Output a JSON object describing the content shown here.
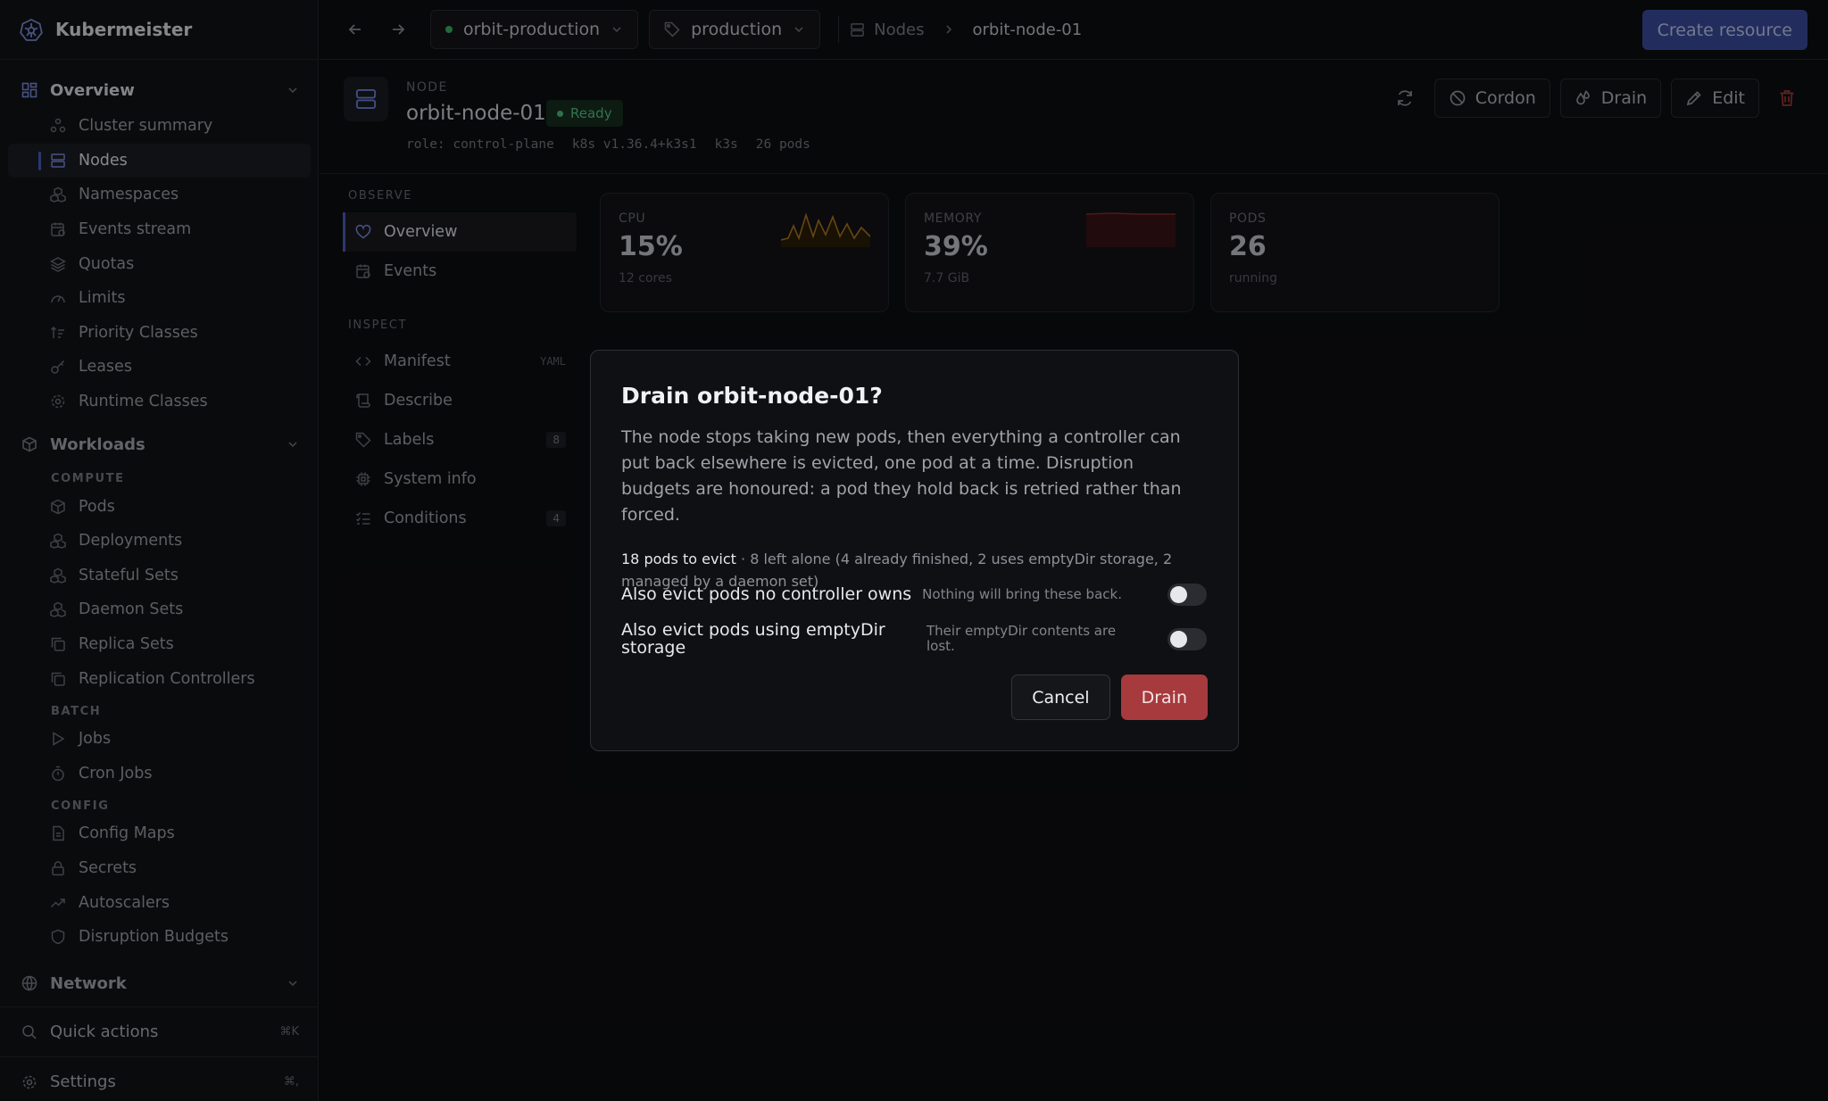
{
  "app": {
    "name": "Kubermeister"
  },
  "sidebar": {
    "overview": {
      "label": "Overview",
      "items": [
        "Cluster summary",
        "Nodes",
        "Namespaces",
        "Events stream",
        "Quotas",
        "Limits",
        "Priority Classes",
        "Leases",
        "Runtime Classes"
      ]
    },
    "workloads": {
      "label": "Workloads",
      "compute_caption": "COMPUTE",
      "compute": [
        "Pods",
        "Deployments",
        "Stateful Sets",
        "Daemon Sets",
        "Replica Sets",
        "Replication Controllers"
      ],
      "batch_caption": "BATCH",
      "batch": [
        "Jobs",
        "Cron Jobs"
      ],
      "config_caption": "CONFIG",
      "config": [
        "Config Maps",
        "Secrets",
        "Autoscalers",
        "Disruption Budgets"
      ]
    },
    "network": {
      "label": "Network"
    },
    "quick_actions": {
      "label": "Quick actions",
      "shortcut": "⌘K"
    },
    "settings": {
      "label": "Settings",
      "shortcut": "⌘,"
    }
  },
  "topbar": {
    "cluster": "orbit-production",
    "context": "production",
    "breadcrumb": {
      "section": "Nodes",
      "current": "orbit-node-01"
    },
    "create_label": "Create resource"
  },
  "node": {
    "kind": "NODE",
    "name": "orbit-node-01",
    "status": "Ready",
    "meta": [
      "role: control-plane",
      "k8s v1.36.4+k3s1",
      "k3s",
      "26 pods"
    ]
  },
  "actions": {
    "cordon": "Cordon",
    "drain": "Drain",
    "edit": "Edit"
  },
  "subnav": {
    "observe_caption": "OBSERVE",
    "overview": "Overview",
    "events": "Events",
    "inspect_caption": "INSPECT",
    "manifest": "Manifest",
    "manifest_tag": "YAML",
    "describe": "Describe",
    "labels": "Labels",
    "labels_count": "8",
    "system_info": "System info",
    "conditions": "Conditions",
    "conditions_count": "4"
  },
  "cards": {
    "cpu": {
      "caption": "CPU",
      "value": "15%",
      "sub": "12 cores"
    },
    "memory": {
      "caption": "MEMORY",
      "value": "39%",
      "sub": "7.7 GiB"
    },
    "pods": {
      "caption": "PODS",
      "value": "26",
      "sub": "running"
    }
  },
  "dialog": {
    "title": "Drain orbit-node-01?",
    "body": "The node stops taking new pods, then everything a controller can put back elsewhere is evicted, one pod at a time. Disruption budgets are honoured: a pod they hold back is retried rather than forced.",
    "summary_strong": "18 pods to evict",
    "summary_rest": " · 8 left alone (4 already finished, 2 uses emptyDir storage, 2 managed by a daemon set)",
    "option1_label": "Also evict pods no controller owns",
    "option1_desc": "Nothing will bring these back.",
    "option2_label": "Also evict pods using emptyDir storage",
    "option2_desc": "Their emptyDir contents are lost.",
    "cancel": "Cancel",
    "confirm": "Drain"
  },
  "colors": {
    "accent": "#3b4ea3",
    "danger": "#a63a3d",
    "ready": "#4fc37e",
    "cpu_spark": "#b07a22",
    "mem_spark": "#8a2a2e"
  }
}
